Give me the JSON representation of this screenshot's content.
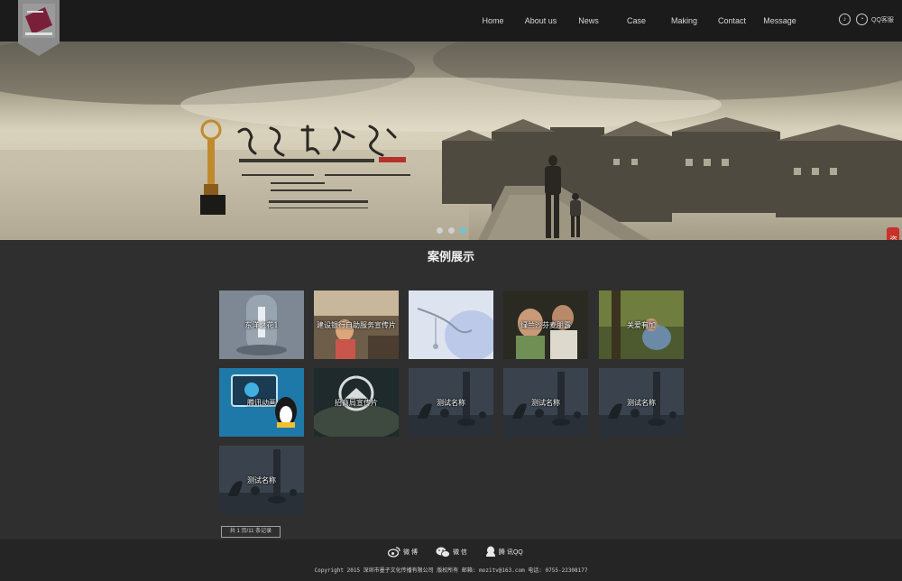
{
  "nav": {
    "items": [
      {
        "label": "Home"
      },
      {
        "label": "About us"
      },
      {
        "label": "News"
      },
      {
        "label": "Case"
      },
      {
        "label": "Making"
      },
      {
        "label": "Contact"
      },
      {
        "label": "Message"
      }
    ]
  },
  "header": {
    "qq_label": "QQ客服"
  },
  "banner": {
    "consult_label": "咨询",
    "dots_count": 3,
    "active_dot_index": 2
  },
  "section": {
    "title": "案例展示"
  },
  "cases": [
    {
      "label": "东洋之花1"
    },
    {
      "label": "建设银行自助服务宣传片"
    },
    {
      "label": ""
    },
    {
      "label": "绿兰沙芬麦朋露"
    },
    {
      "label": "关爱有加"
    },
    {
      "label": "腾讯动画"
    },
    {
      "label": "招商局宣传片"
    },
    {
      "label": "测试名称"
    },
    {
      "label": "测试名称"
    },
    {
      "label": "测试名称"
    },
    {
      "label": "测试名称"
    }
  ],
  "pager": {
    "text": "共 1 页/11 条记录"
  },
  "footer": {
    "social": [
      {
        "label": "微 博",
        "icon": "weibo-icon"
      },
      {
        "label": "微 信",
        "icon": "wechat-icon"
      },
      {
        "label": "腾 讯QQ",
        "icon": "qq-icon"
      }
    ],
    "copyright": "Copyright 2015 深圳市墨子文化传播有限公司 版权所有 邮箱: mozitv@163.com 电话: 0755-22308177"
  },
  "colors": {
    "accent": "#6ec3d7",
    "consult": "#c8322b",
    "logo": "#7a1f3a"
  }
}
